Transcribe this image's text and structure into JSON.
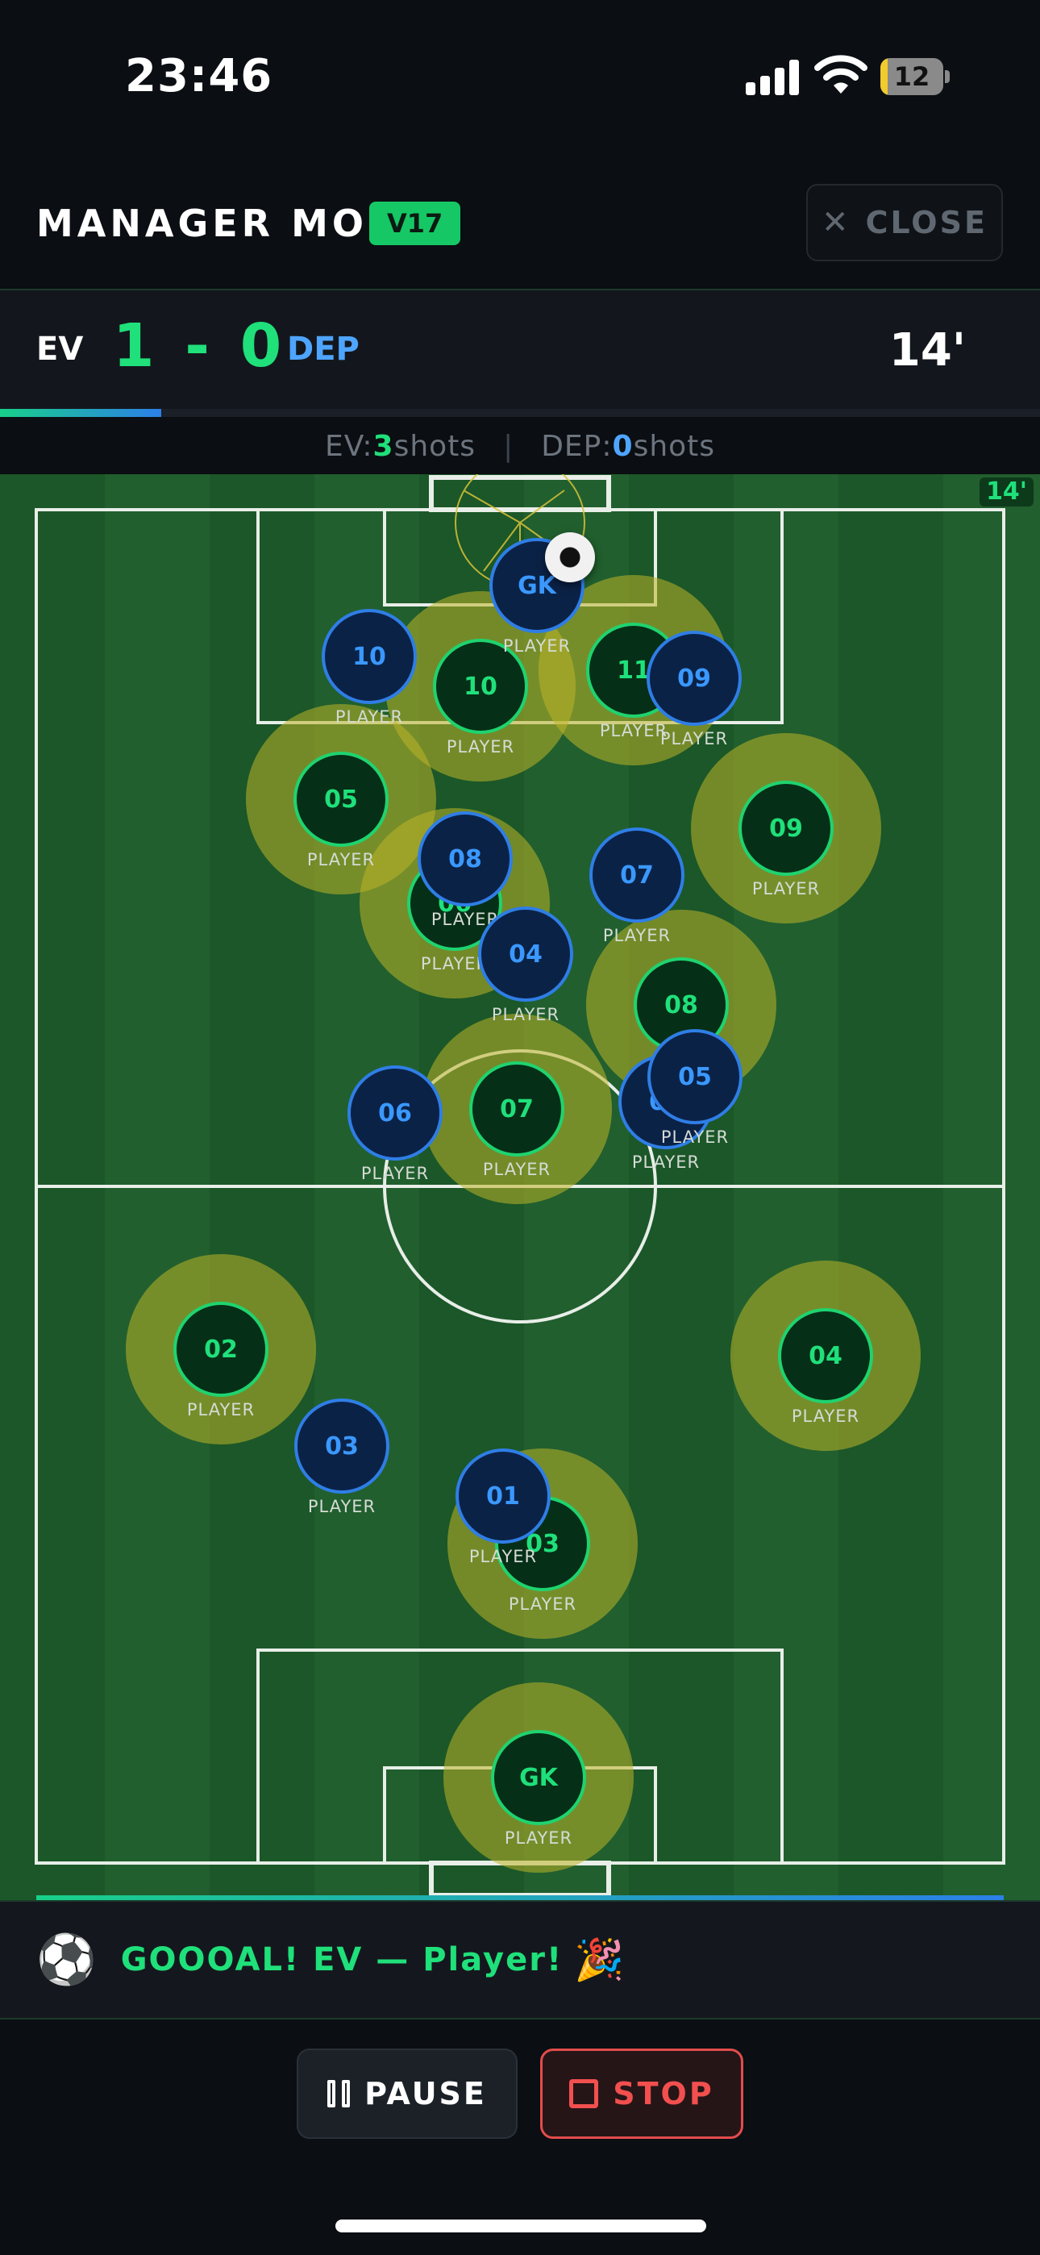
{
  "status_bar": {
    "time": "23:46",
    "battery_level": "12",
    "icons": [
      "signal-icon",
      "wifi-icon",
      "battery-icon"
    ]
  },
  "header": {
    "title": "MANAGER MODE",
    "version": "V17",
    "close_label": "CLOSE",
    "close_icon": "✕"
  },
  "scoreboard": {
    "home_abbr": "EV",
    "away_abbr": "DEP",
    "score": "1 - 0",
    "clock": "14'",
    "progress_fraction": 0.155
  },
  "shots": {
    "home_label": "EV: ",
    "home_count": "3",
    "away_label": "DEP: ",
    "away_count": "0",
    "unit": " shots",
    "separator": "|"
  },
  "pitch": {
    "clock_tag": "14'",
    "colors": {
      "home": "#1fe07a",
      "away": "#3a98ff",
      "heat": "#bea f28"
    },
    "home_players": [
      {
        "number": "10",
        "name": "PLAYER",
        "heat": true
      },
      {
        "number": "11",
        "name": "PLAYER",
        "heat": true
      },
      {
        "number": "05",
        "name": "PLAYER",
        "heat": true
      },
      {
        "number": "09",
        "name": "PLAYER",
        "heat": true
      },
      {
        "number": "06",
        "name": "PLAYER",
        "heat": true
      },
      {
        "number": "08",
        "name": "PLAYER",
        "heat": true
      },
      {
        "number": "07",
        "name": "PLAYER",
        "heat": true
      },
      {
        "number": "02",
        "name": "PLAYER",
        "heat": true
      },
      {
        "number": "04",
        "name": "PLAYER",
        "heat": true
      },
      {
        "number": "03",
        "name": "PLAYER",
        "heat": true
      },
      {
        "number": "GK",
        "name": "PLAYER",
        "heat": true
      }
    ],
    "away_players": [
      {
        "number": "GK",
        "name": "PLAYER"
      },
      {
        "number": "10",
        "name": "PLAYER"
      },
      {
        "number": "09",
        "name": "PLAYER"
      },
      {
        "number": "08",
        "name": "PLAYER"
      },
      {
        "number": "07",
        "name": "PLAYER"
      },
      {
        "number": "04",
        "name": "PLAYER"
      },
      {
        "number": "06",
        "name": "PLAYER"
      },
      {
        "number": "06",
        "name": "PLAYER"
      },
      {
        "number": "05",
        "name": "PLAYER"
      },
      {
        "number": "03",
        "name": "PLAYER"
      },
      {
        "number": "01",
        "name": "PLAYER"
      }
    ]
  },
  "event": {
    "icon": "⚽",
    "text": "GOOOAL! EV — Player!",
    "emoji": "🎉"
  },
  "controls": {
    "pause_label": "PAUSE",
    "stop_label": "STOP"
  }
}
